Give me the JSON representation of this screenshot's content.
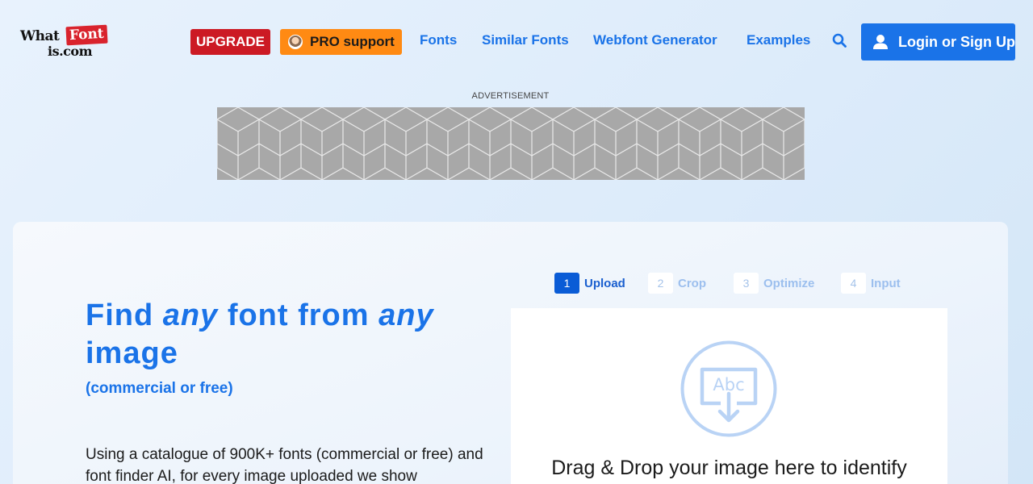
{
  "header": {
    "logo": {
      "part1": "What",
      "part2": "Font",
      "part3": "is.com"
    },
    "upgrade_label": "UPGRADE",
    "pro_label": "PRO support",
    "nav": [
      {
        "label": "Fonts"
      },
      {
        "label": "Similar Fonts"
      },
      {
        "label": "Webfont Generator"
      },
      {
        "label": "Examples"
      }
    ],
    "login_label": "Login or Sign Up",
    "icons": [
      "search-icon",
      "user-icon"
    ]
  },
  "ad": {
    "label": "ADVERTISEMENT"
  },
  "hero": {
    "title_find": "Find",
    "title_any1": "any",
    "title_font_from": "font from",
    "title_any2": "any",
    "title_image": "image",
    "subtitle": "(commercial or free)",
    "description": "Using a catalogue of 900K+ fonts (commercial or free) and font finder AI, for every image uploaded we show"
  },
  "steps": [
    {
      "num": "1",
      "label": "Upload",
      "active": true
    },
    {
      "num": "2",
      "label": "Crop",
      "active": false
    },
    {
      "num": "3",
      "label": "Optimize",
      "active": false
    },
    {
      "num": "4",
      "label": "Input",
      "active": false
    }
  ],
  "dropzone": {
    "icon_text": "Abc",
    "text": "Drag & Drop your image here to identify"
  },
  "colors": {
    "brand_blue": "#1a73e8",
    "upgrade_red": "#cc1a24",
    "pro_orange": "#ff8a13",
    "step_active": "#0a5cd6",
    "step_inactive": "#9cbfee"
  }
}
